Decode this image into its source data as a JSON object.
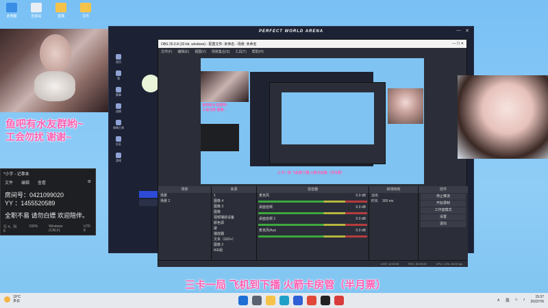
{
  "desktop": {
    "icons": [
      {
        "label": "此电脑",
        "color": "#3a8ee6"
      },
      {
        "label": "回收站",
        "color": "#e9eef5"
      },
      {
        "label": "直播",
        "color": "#f6c34a"
      },
      {
        "label": "文件",
        "color": "#f6c34a"
      }
    ]
  },
  "overlay": {
    "line1": "鱼吧有水友群哟~",
    "line2": "工会勿扰 谢谢~",
    "bottom_subtitle": "三卡一局 飞机到下播 火箭卡房管（半月票）"
  },
  "notepad": {
    "title": "*小字 - 记事本",
    "menu": [
      "文件",
      "编辑",
      "查看"
    ],
    "lines": [
      "房间号：0421099020",
      "YY ：1455520589",
      "",
      "全职不易 请勿白嫖 欢迎陪伴。"
    ],
    "status": [
      "行 4，列 8",
      "100%",
      "Windows (CRLF)",
      "UTF-8"
    ]
  },
  "pwa": {
    "title": "PERFECT WORLD ARENA",
    "sidebar": [
      "首页",
      "我",
      "赛事",
      "战绩",
      "商城工具",
      "社区",
      "游戏"
    ]
  },
  "obs": {
    "title": "OBS 25.0.8 (32-bit, windows) - 配置文件: 未命名 - 场景: 未命名",
    "menu": [
      "文件(F)",
      "编辑(E)",
      "视图(V)",
      "场景集合(S)",
      "工具(T)",
      "帮助(H)"
    ],
    "docks": {
      "scenes": {
        "header": "场景",
        "items": [
          "场景",
          "场景 2"
        ]
      },
      "sources": {
        "header": "来源",
        "items": [
          "1",
          "图像 4",
          "图像 3",
          "图像",
          "视频捕获设备",
          "颜色源",
          "歌",
          "播放器",
          "文本（GDI+）",
          "图像 2",
          "IKE组"
        ]
      },
      "mixer": {
        "header": "混音器",
        "channels": [
          {
            "name": "麦克风",
            "db": "0.0 dB"
          },
          {
            "name": "桌面音频",
            "db": "0.0 dB"
          },
          {
            "name": "桌面音频 2",
            "db": "0.0 dB"
          },
          {
            "name": "麦克风/Aux",
            "db": "0.0 dB"
          }
        ]
      },
      "transitions": {
        "header": "转场特效",
        "type": "淡出",
        "duration_label": "时长",
        "duration": "300 ms"
      },
      "controls": {
        "header": "控件",
        "buttons": [
          "停止推流",
          "开始录制",
          "工作室模式",
          "设置",
          "退出"
        ]
      }
    },
    "status": [
      "LIVE: 12:00:00",
      "REC: 00:00:00",
      "CPU: 1.3%, 50.00 fps"
    ]
  },
  "taskbar": {
    "weather_temp": "19°C",
    "weather_desc": "多云",
    "tray_lang": "英",
    "time": "15:37",
    "date": "2022/7/6",
    "icons": [
      "windows",
      "search",
      "files",
      "edge",
      "store",
      "chrome",
      "obs",
      "app"
    ]
  }
}
